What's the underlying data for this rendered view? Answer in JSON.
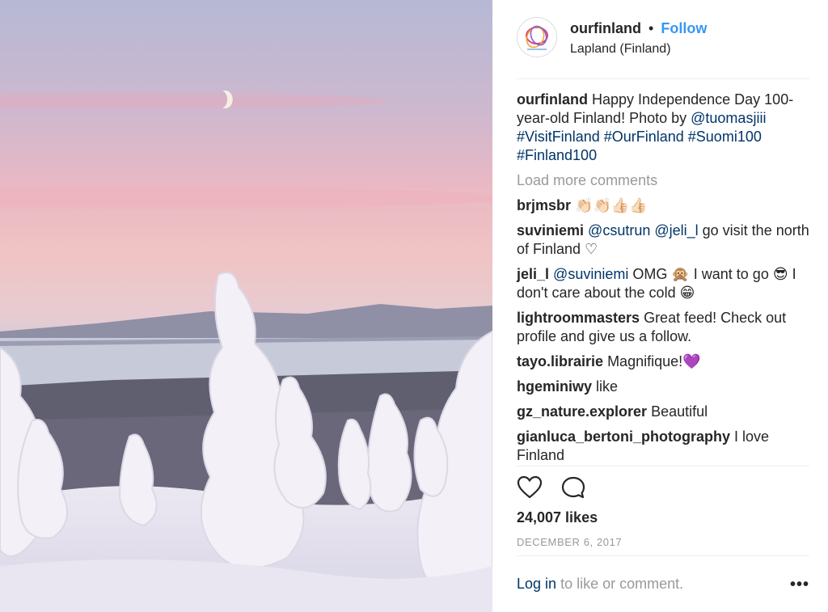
{
  "post": {
    "username": "ourfinland",
    "separator": "•",
    "follow_label": "Follow",
    "location": "Lapland (Finland)",
    "caption": {
      "author": "ourfinland",
      "text": "Happy Independence Day 100-year-old Finland! Photo by",
      "mention": "@tuomasjiii",
      "hashtags": "#VisitFinland #OurFinland #Suomi100 #Finland100"
    },
    "load_more_label": "Load more comments",
    "comments": [
      {
        "user": "brjmsbr",
        "text": "👏🏻👏🏻👍🏻👍🏻"
      },
      {
        "user": "suviniemi",
        "mentions": "@csutrun @jeli_l",
        "text": "go visit the north of Finland ♡"
      },
      {
        "user": "jeli_l",
        "mentions": "@suviniemi",
        "text": "OMG 🙊 I want to go 😎 I don't care about the cold 😁"
      },
      {
        "user": "lightroommasters",
        "text": "Great feed! Check out profile and give us a follow."
      },
      {
        "user": "tayo.librairie",
        "text": "Magnifique!💜"
      },
      {
        "user": "hgeminiwy",
        "text": "like"
      },
      {
        "user": "gz_nature.explorer",
        "text": "Beautiful"
      },
      {
        "user": "gianluca_bertoni_photography",
        "text": "I love Finland"
      }
    ],
    "icons": {
      "like": "heart-icon",
      "comment": "comment-bubble-icon",
      "more": "more-options-icon"
    },
    "likes": "24,007 likes",
    "date": "DECEMBER 6, 2017",
    "login_link": "Log in",
    "login_text": "to like or comment.",
    "more_label": "•••"
  }
}
